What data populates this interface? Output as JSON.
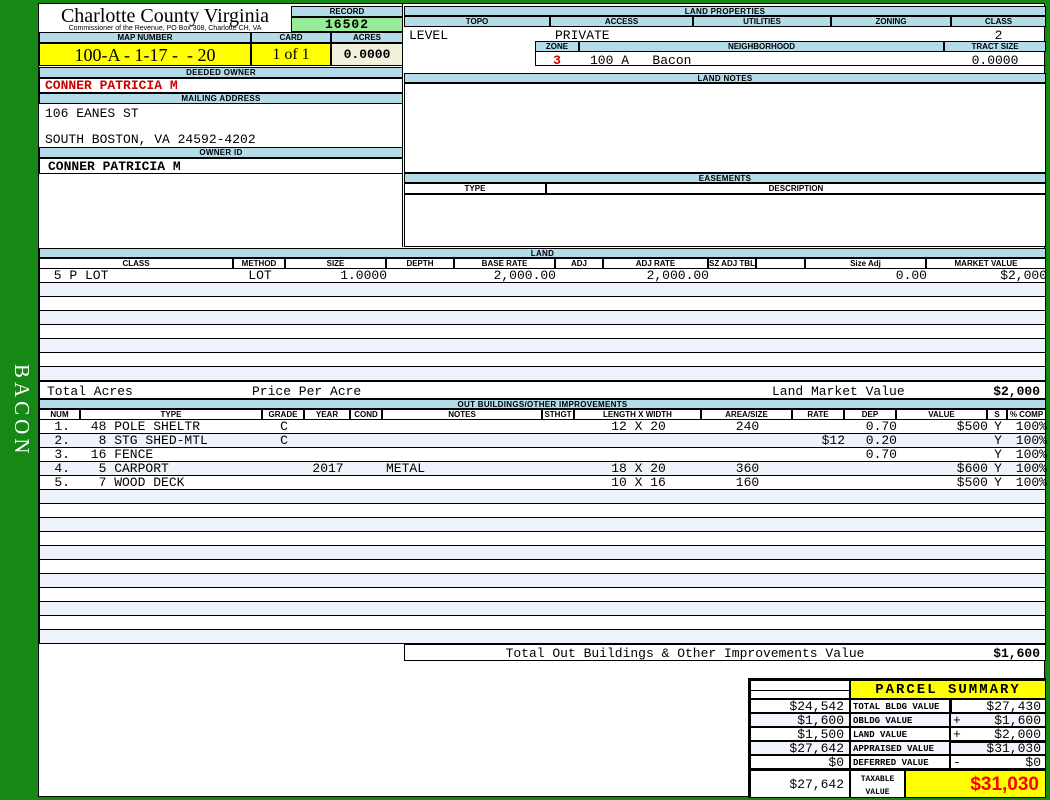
{
  "sidebar": {
    "district": "BACON"
  },
  "header": {
    "county": "Charlotte County Virginia",
    "commissioner": "Commissioner of the Revenue, PO Box 308, Charlotte CH, VA",
    "record_label": "RECORD",
    "record_value": "16502",
    "map_number_label": "MAP NUMBER",
    "map_number": "100-A - 1-17 -  - 20",
    "card_label": "CARD",
    "card_value": "1 of 1",
    "acres_label": "ACRES",
    "acres_value": "0.0000"
  },
  "owner": {
    "deeded_owner_label": "DEEDED OWNER",
    "deeded_owner": "CONNER PATRICIA M",
    "mailing_address_label": "MAILING ADDRESS",
    "address_line1": "106 EANES ST",
    "address_line2": "SOUTH BOSTON, VA 24592-4202",
    "owner_id_label": "OWNER ID",
    "owner_id": "CONNER PATRICIA M"
  },
  "land_properties": {
    "title": "LAND PROPERTIES",
    "topo_label": "TOPO",
    "topo": "LEVEL",
    "access_label": "ACCESS",
    "access": "PRIVATE",
    "utilities_label": "UTILITIES",
    "utilities": "",
    "zoning_label": "ZONING",
    "zoning": "",
    "class_label": "CLASS",
    "class": "2",
    "zone_label": "ZONE",
    "zone": "3",
    "neighborhood_label": "NEIGHBORHOOD",
    "neighborhood": "100 A   Bacon",
    "tract_size_label": "TRACT SIZE",
    "tract_size": "0.0000"
  },
  "land_notes": {
    "title": "LAND NOTES"
  },
  "easements": {
    "title": "EASEMENTS",
    "type_label": "TYPE",
    "description_label": "DESCRIPTION"
  },
  "land": {
    "title": "LAND",
    "headers": [
      "CLASS",
      "METHOD",
      "SIZE",
      "DEPTH",
      "BASE RATE",
      "ADJ",
      "ADJ RATE",
      "SZ ADJ TBL",
      "",
      "Size Adj",
      "MARKET VALUE"
    ],
    "row": {
      "class": " 5 P LOT",
      "method": "LOT",
      "size": "1.0000",
      "depth": "",
      "base_rate": "2,000.00",
      "adj": "",
      "adj_rate": "2,000.00",
      "sz_adj_tbl": "",
      "size_adj": "0.00",
      "market_value": "$2,000"
    },
    "total_acres_label": "Total Acres",
    "price_per_acre_label": "Price Per Acre",
    "land_market_value_label": "Land Market Value",
    "land_market_value": "$2,000"
  },
  "out_buildings": {
    "title": "OUT BUILDINGS/OTHER IMPROVEMENTS",
    "headers": [
      "NUM",
      "TYPE",
      "GRADE",
      "YEAR",
      "COND",
      "NOTES",
      "STHGT",
      "LENGTH X WIDTH",
      "AREA/SIZE",
      "RATE",
      "DEP",
      "VALUE",
      "S",
      "% COMP"
    ],
    "rows": [
      {
        "num": "1.",
        "type": " 48 POLE SHELTR",
        "grade": "C",
        "year": "",
        "cond": "",
        "notes": "",
        "sthgt": "",
        "lxw": "12 X 20",
        "area": "240",
        "rate": "",
        "dep": "0.70",
        "value": "$500",
        "s": "Y",
        "comp": "100%"
      },
      {
        "num": "2.",
        "type": "  8 STG SHED-MTL",
        "grade": "C",
        "year": "",
        "cond": "",
        "notes": "",
        "sthgt": "",
        "lxw": "",
        "area": "",
        "rate": "$12",
        "dep": "0.20",
        "value": "",
        "s": "Y",
        "comp": "100%"
      },
      {
        "num": "3.",
        "type": " 16 FENCE",
        "grade": "",
        "year": "",
        "cond": "",
        "notes": "",
        "sthgt": "",
        "lxw": "",
        "area": "",
        "rate": "",
        "dep": "0.70",
        "value": "",
        "s": "Y",
        "comp": "100%"
      },
      {
        "num": "4.",
        "type": "  5 CARPORT",
        "grade": "",
        "year": "2017",
        "cond": "",
        "notes": "METAL",
        "sthgt": "",
        "lxw": "18 X 20",
        "area": "360",
        "rate": "",
        "dep": "",
        "value": "$600",
        "s": "Y",
        "comp": "100%"
      },
      {
        "num": "5.",
        "type": "  7 WOOD DECK",
        "grade": "",
        "year": "",
        "cond": "",
        "notes": "",
        "sthgt": "",
        "lxw": "10 X 16",
        "area": "160",
        "rate": "",
        "dep": "",
        "value": "$500",
        "s": "Y",
        "comp": "100%"
      }
    ],
    "total_label": "Total Out Buildings & Other Improvements Value",
    "total_value": "$1,600"
  },
  "parcel_summary": {
    "title": "PARCEL SUMMARY",
    "rows": [
      {
        "left": "$24,542",
        "label": "TOTAL BLDG VALUE",
        "op": "",
        "value": "$27,430"
      },
      {
        "left": "$1,600",
        "label": "OBLDG VALUE",
        "op": "+",
        "value": "$1,600"
      },
      {
        "left": "$1,500",
        "label": "LAND VALUE",
        "op": "+",
        "value": "$2,000"
      },
      {
        "left": "$27,642",
        "label": "APPRAISED VALUE",
        "op": "",
        "value": "$31,030"
      },
      {
        "left": "$0",
        "label": "DEFERRED VALUE",
        "op": "-",
        "value": "$0"
      },
      {
        "left": "$27,642",
        "label": "TAXABLE VALUE",
        "op": "",
        "value": "$31,030"
      }
    ]
  }
}
